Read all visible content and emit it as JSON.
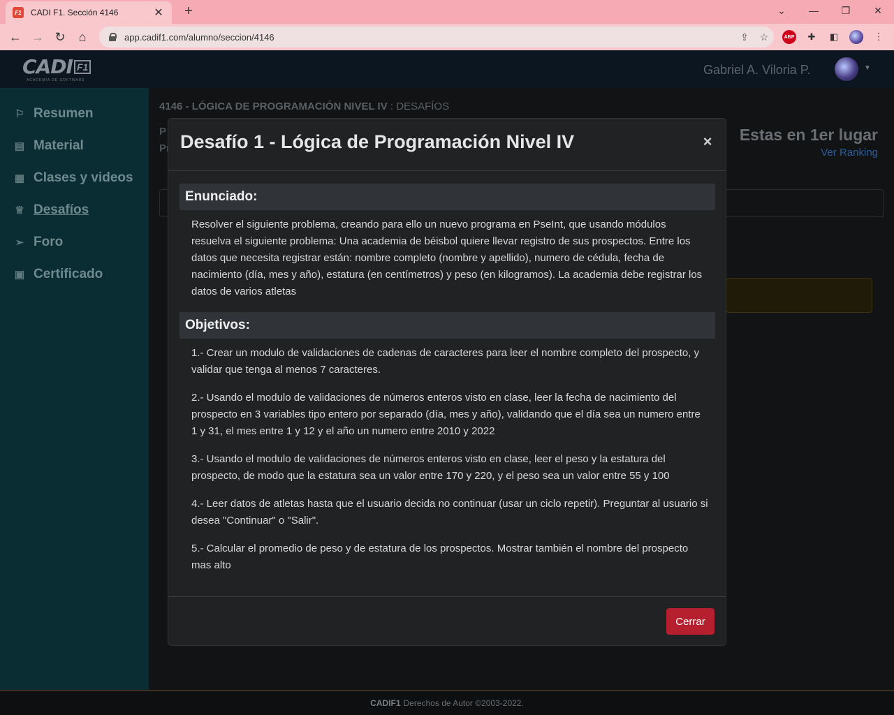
{
  "browser": {
    "tab_title": "CADI F1. Sección 4146",
    "tab_favicon_text": "F1",
    "url": "app.cadif1.com/alumno/seccion/4146",
    "abp_badge": "ABP"
  },
  "header": {
    "logo_text": "CADI",
    "logo_badge": "F1",
    "logo_subtitle": "ACADEMIA DE SOFTWARE",
    "username": "Gabriel A. Viloria P."
  },
  "sidebar": {
    "items": [
      {
        "label": "Resumen",
        "icon": "flag-icon"
      },
      {
        "label": "Material",
        "icon": "book-icon"
      },
      {
        "label": "Clases y videos",
        "icon": "calendar-icon"
      },
      {
        "label": "Desafíos",
        "icon": "trophy-icon",
        "active": true
      },
      {
        "label": "Foro",
        "icon": "paper-plane-icon"
      },
      {
        "label": "Certificado",
        "icon": "certificate-icon"
      }
    ]
  },
  "main": {
    "title": "4146 - LÓGICA DE PROGRAMACIÓN NIVEL IV",
    "title_sub": " : DESAFÍOS",
    "frag1": "P",
    "frag2": "Pr",
    "rank_title": "Estas en 1er lugar",
    "rank_link": "Ver Ranking"
  },
  "modal": {
    "title": "Desafío 1 - Lógica de Programación Nivel IV",
    "close_glyph": "×",
    "enunciado_heading": "Enunciado:",
    "enunciado_text": "Resolver el siguiente problema, creando para ello un nuevo programa en PseInt, que usando módulos resuelva el siguiente problema: Una academia de béisbol quiere llevar registro de sus prospectos. Entre los datos que necesita registrar están: nombre completo (nombre y apellido), numero de cédula, fecha de nacimiento (día, mes y año), estatura (en centímetros) y peso (en kilogramos). La academia debe registrar los datos de varios atletas",
    "objetivos_heading": "Objetivos:",
    "objetivos": [
      "1.- Crear un modulo de validaciones de cadenas de caracteres para leer el nombre completo del prospecto, y validar que tenga al menos 7 caracteres.",
      "2.- Usando el modulo de validaciones de números enteros visto en clase, leer la fecha de nacimiento del prospecto en 3 variables tipo entero por separado (día, mes y año), validando que el día sea un numero entre 1 y 31, el mes entre 1 y 12 y el año un numero entre 2010 y 2022",
      "3.- Usando el modulo de validaciones de números enteros visto en clase, leer el peso y la estatura del prospecto, de modo que la estatura sea un valor entre 170 y 220, y el peso sea un valor entre 55 y 100",
      "4.- Leer datos de atletas hasta que el usuario decida no continuar (usar un ciclo repetir). Preguntar al usuario si desea \"Continuar\" o \"Salir\".",
      "5.- Calcular el promedio de peso y de estatura de los prospectos. Mostrar también el nombre del prospecto mas alto"
    ],
    "close_button": "Cerrar"
  },
  "footer": {
    "brand": "CADIF1",
    "text": "Derechos de Autor ©2003-2022."
  }
}
